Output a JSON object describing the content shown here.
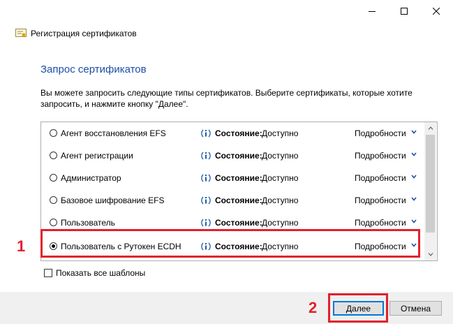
{
  "window": {
    "title": "Регистрация сертификатов",
    "controls": [
      "minimize-icon",
      "maximize-icon",
      "close-icon"
    ]
  },
  "page": {
    "heading": "Запрос сертификатов",
    "description": "Вы можете запросить следующие типы сертификатов. Выберите сертификаты, которые хотите запросить, и нажмите кнопку \"Далее\"."
  },
  "certificates": [
    {
      "label": "Агент восстановления EFS",
      "status_label": "Состояние:",
      "status_value": "Доступно",
      "details": "Подробности",
      "selected": false
    },
    {
      "label": "Агент регистрации",
      "status_label": "Состояние:",
      "status_value": "Доступно",
      "details": "Подробности",
      "selected": false
    },
    {
      "label": "Администратор",
      "status_label": "Состояние:",
      "status_value": "Доступно",
      "details": "Подробности",
      "selected": false
    },
    {
      "label": "Базовое шифрование EFS",
      "status_label": "Состояние:",
      "status_value": "Доступно",
      "details": "Подробности",
      "selected": false
    },
    {
      "label": "Пользователь",
      "status_label": "Состояние:",
      "status_value": "Доступно",
      "details": "Подробности",
      "selected": false
    },
    {
      "label": "Пользователь с Рутокен ECDH",
      "status_label": "Состояние:",
      "status_value": "Доступно",
      "details": "Подробности",
      "selected": true
    }
  ],
  "show_all_templates": {
    "label": "Показать все шаблоны",
    "checked": false
  },
  "buttons": {
    "next": "Далее",
    "cancel": "Отмена"
  },
  "annotations": {
    "step1": "1",
    "step2": "2"
  },
  "colors": {
    "heading": "#1c4fa6",
    "highlight": "#e2202c",
    "info_icon": "#1e5aa8",
    "chevron": "#1c4fa6"
  }
}
